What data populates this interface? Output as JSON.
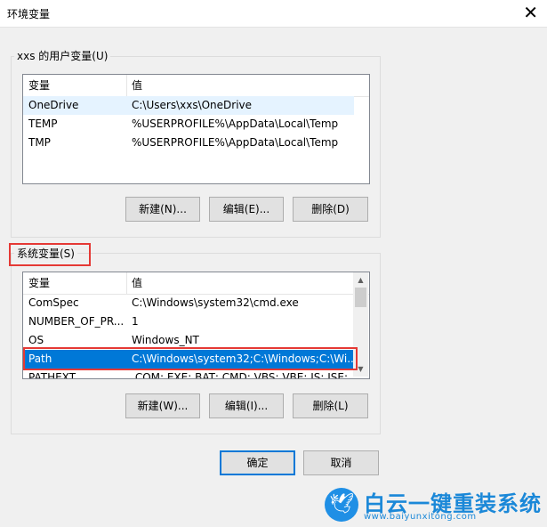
{
  "window": {
    "title": "环境变量",
    "close_glyph": "✕"
  },
  "user_vars": {
    "group_label": "xxs 的用户变量(U)",
    "columns": [
      "变量",
      "值"
    ],
    "rows": [
      {
        "name": "OneDrive",
        "value": "C:\\Users\\xxs\\OneDrive"
      },
      {
        "name": "TEMP",
        "value": "%USERPROFILE%\\AppData\\Local\\Temp"
      },
      {
        "name": "TMP",
        "value": "%USERPROFILE%\\AppData\\Local\\Temp"
      }
    ],
    "buttons": {
      "new": "新建(N)...",
      "edit": "编辑(E)...",
      "delete": "删除(D)"
    }
  },
  "system_vars": {
    "group_label": "系统变量(S)",
    "columns": [
      "变量",
      "值"
    ],
    "rows": [
      {
        "name": "ComSpec",
        "value": "C:\\Windows\\system32\\cmd.exe"
      },
      {
        "name": "NUMBER_OF_PR...",
        "value": "1"
      },
      {
        "name": "OS",
        "value": "Windows_NT"
      },
      {
        "name": "Path",
        "value": "C:\\Windows\\system32;C:\\Windows;C:\\Wi..."
      },
      {
        "name": "PATHEXT",
        "value": ".COM;.EXE;.BAT;.CMD;.VBS;.VBE;.JS;.JSE;"
      }
    ],
    "selected_row": "Path",
    "buttons": {
      "new": "新建(W)...",
      "edit": "编辑(I)...",
      "delete": "删除(L)"
    }
  },
  "dialog_buttons": {
    "ok": "确定",
    "cancel": "取消"
  },
  "watermark": {
    "brand": "白云一键重装系统",
    "url": "www.baiyunxitong.com",
    "logo_icon": "bird-icon"
  },
  "highlight_color": "#e53935",
  "selection_color": "#0078d7"
}
